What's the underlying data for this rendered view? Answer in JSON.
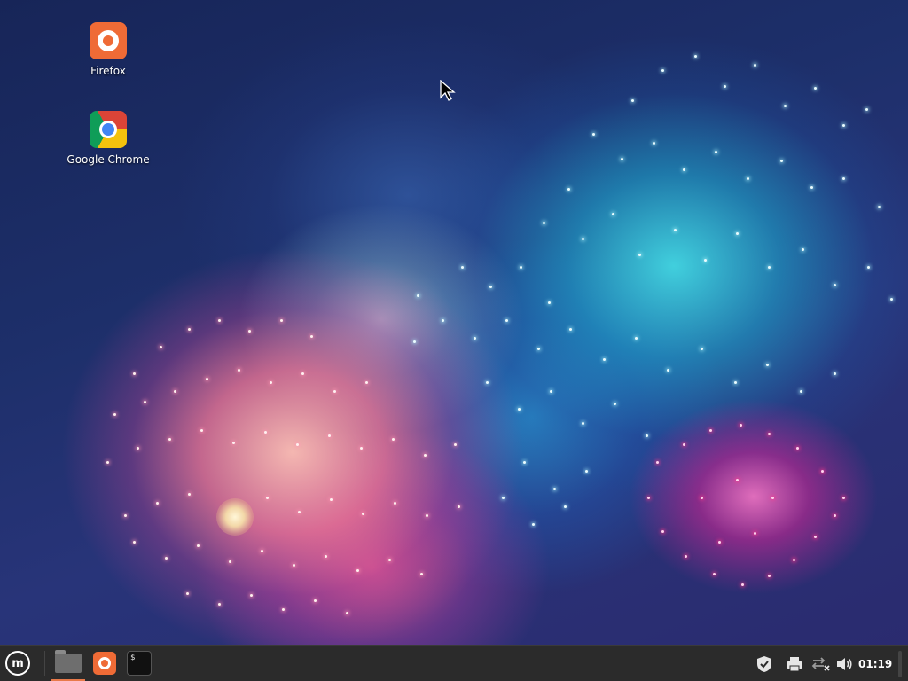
{
  "desktop": {
    "icons": [
      {
        "label": "Firefox",
        "icon": "firefox-icon"
      },
      {
        "label": "Google Chrome",
        "icon": "chrome-icon"
      }
    ]
  },
  "taskbar": {
    "menu_icon": "linux-mint-logo-icon",
    "launchers": [
      {
        "name": "Files",
        "icon": "folder-icon",
        "active": true
      },
      {
        "name": "Firefox",
        "icon": "firefox-icon",
        "active": false
      },
      {
        "name": "Terminal",
        "icon": "terminal-icon",
        "glyph": "$_",
        "active": false
      }
    ],
    "tray": [
      {
        "icon": "shield-icon"
      },
      {
        "icon": "printer-icon"
      },
      {
        "icon": "network-disconnected-icon"
      },
      {
        "icon": "volume-icon"
      }
    ],
    "clock": "01:19",
    "accent_color": "#e87a4a"
  }
}
